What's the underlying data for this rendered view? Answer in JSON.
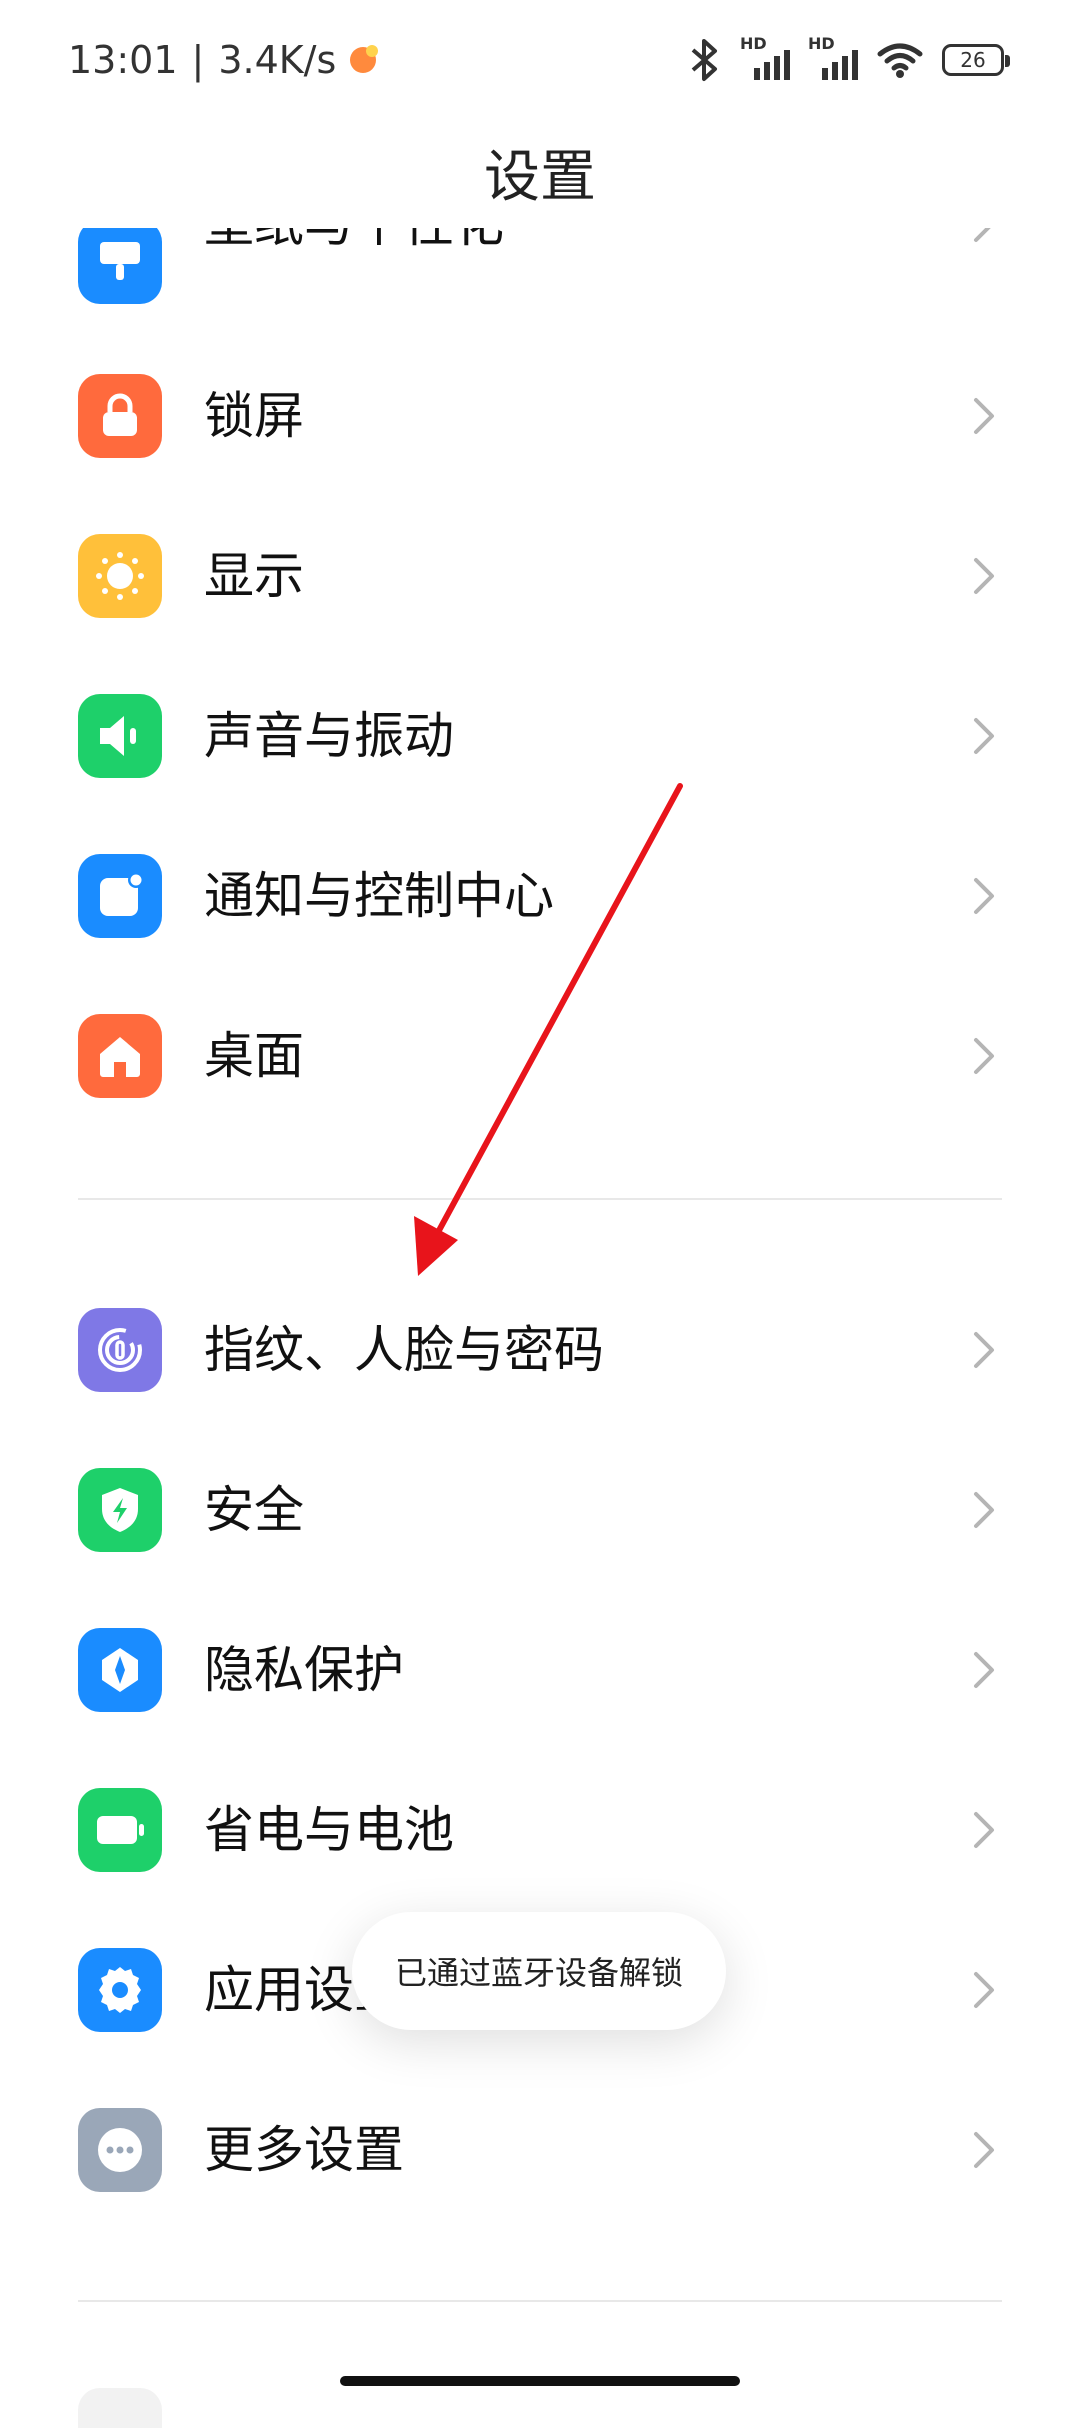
{
  "status_bar": {
    "time": "13:01",
    "separator": "|",
    "speed": "3.4K/s",
    "hd1": "HD",
    "hd2": "HD",
    "battery": "26"
  },
  "page": {
    "title": "设置"
  },
  "items": [
    {
      "label": "壁纸与个性化",
      "icon": "wallpaper-icon",
      "color": "#1a8cff"
    },
    {
      "label": "锁屏",
      "icon": "lock-icon",
      "color": "#ff6a3d"
    },
    {
      "label": "显示",
      "icon": "sun-icon",
      "color": "#ffc03a"
    },
    {
      "label": "声音与振动",
      "icon": "speaker-icon",
      "color": "#1ed06a"
    },
    {
      "label": "通知与控制中心",
      "icon": "notification-icon",
      "color": "#1a8cff"
    },
    {
      "label": "桌面",
      "icon": "home-icon",
      "color": "#ff6a3d"
    },
    {
      "label": "指纹、人脸与密码",
      "icon": "fingerprint-icon",
      "color": "#7f78e6"
    },
    {
      "label": "安全",
      "icon": "shield-icon",
      "color": "#1ed06a"
    },
    {
      "label": "隐私保护",
      "icon": "privacy-icon",
      "color": "#1a8cff"
    },
    {
      "label": "省电与电池",
      "icon": "battery-icon",
      "color": "#1ed06a"
    },
    {
      "label": "应用设置",
      "icon": "gear-icon",
      "color": "#1a8cff"
    },
    {
      "label": "更多设置",
      "icon": "more-icon",
      "color": "#9aa7b8"
    }
  ],
  "toast": {
    "text": "已通过蓝牙设备解锁"
  },
  "annotation_color": "#e8141b"
}
